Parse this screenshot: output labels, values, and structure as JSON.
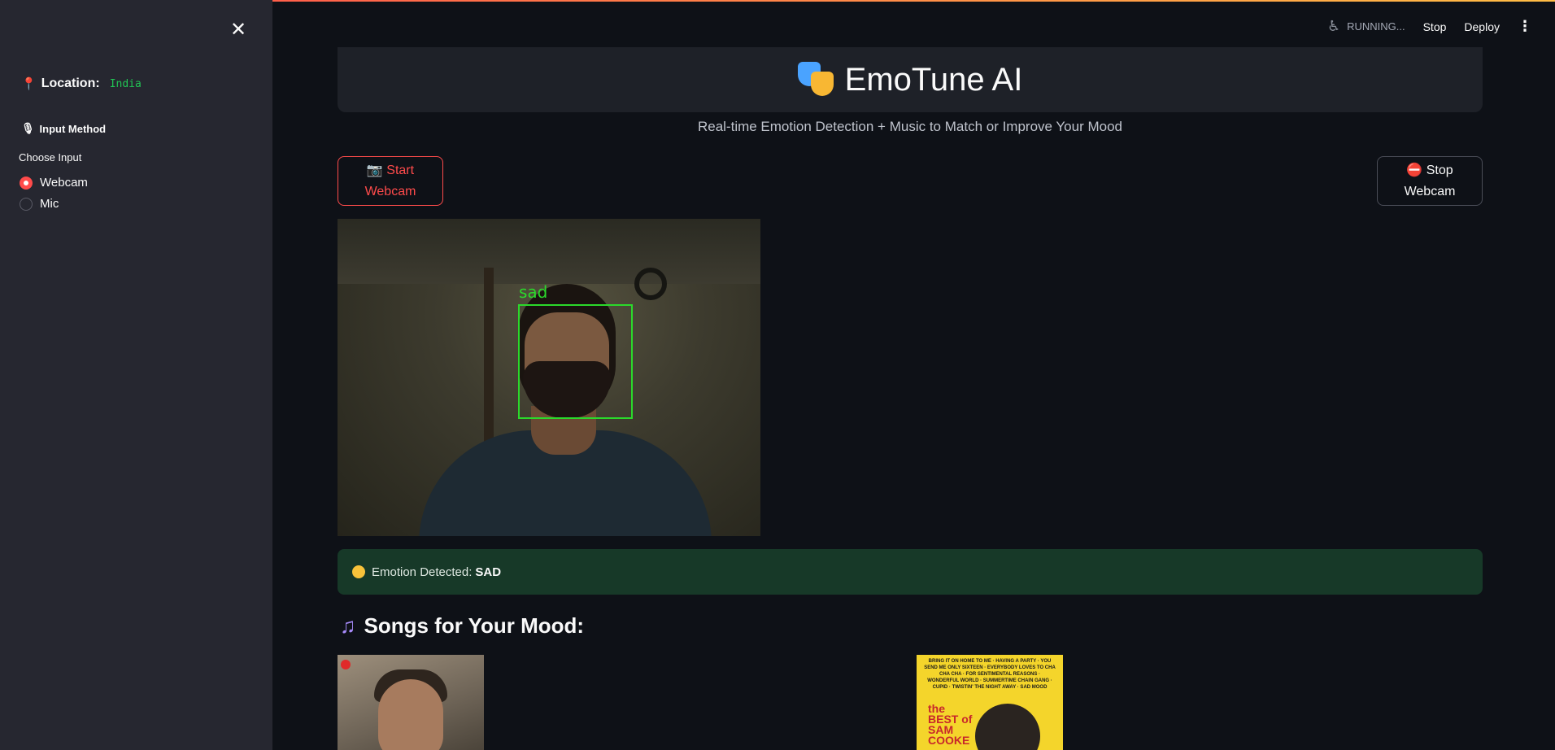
{
  "sidebar": {
    "location_label": "Location:",
    "location_value": "India",
    "input_method_label": "Input Method",
    "choose_input_label": "Choose Input",
    "options": [
      "Webcam",
      "Mic"
    ],
    "selected": "Webcam"
  },
  "toolbar": {
    "status": "RUNNING...",
    "stop": "Stop",
    "deploy": "Deploy"
  },
  "header": {
    "title": "EmoTune AI",
    "subtitle": "Real-time Emotion Detection + Music to Match or Improve Your Mood"
  },
  "controls": {
    "start_webcam": "📷 Start Webcam",
    "stop_webcam": "⛔ Stop Webcam"
  },
  "webcam": {
    "detected_label": "sad"
  },
  "result": {
    "prefix": "Emotion Detected: ",
    "emotion": "SAD"
  },
  "songs": {
    "heading": "Songs for Your Mood:",
    "album2_text": "BRING IT ON HOME TO ME · HAVING A PARTY · YOU SEND ME ONLY SIXTEEN · EVERYBODY LOVES TO CHA CHA CHA · FOR SENTIMENTAL REASONS · WONDERFUL WORLD · SUMMERTIME CHAIN GANG · CUPID · TWISTIN' THE NIGHT AWAY · SAD MOOD",
    "album2_title": "the BEST of SAM COOKE"
  },
  "colors": {
    "accent": "#ff4b4b",
    "success_bg": "#173928",
    "box": "#2bd92b"
  }
}
